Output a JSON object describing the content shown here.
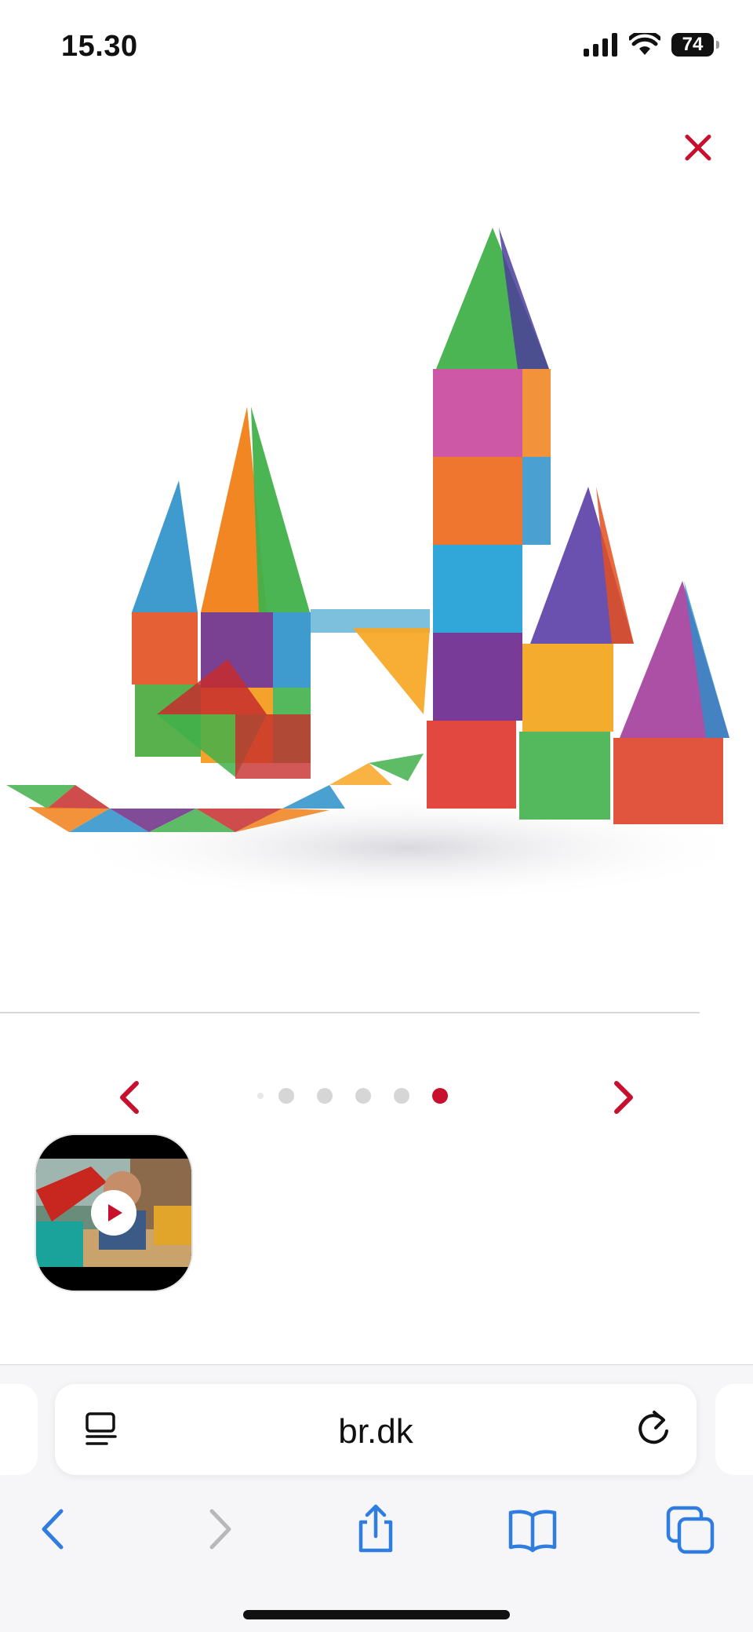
{
  "status_bar": {
    "time": "15.30",
    "battery": "74"
  },
  "gallery": {
    "total": 5,
    "active_index": 4
  },
  "browser": {
    "url": "br.dk"
  },
  "colors": {
    "accent": "#c8102e",
    "toolbar_blue": "#2f7de1",
    "disabled": "#b8b8bc"
  },
  "icons": {
    "close": "close-icon",
    "prev": "chevron-left-icon",
    "next": "chevron-right-icon",
    "play": "play-icon",
    "reader": "reader-mode-icon",
    "reload": "reload-icon",
    "back": "back-icon",
    "forward": "forward-icon",
    "share": "share-icon",
    "bookmarks": "bookmarks-icon",
    "tabs": "tabs-icon"
  }
}
